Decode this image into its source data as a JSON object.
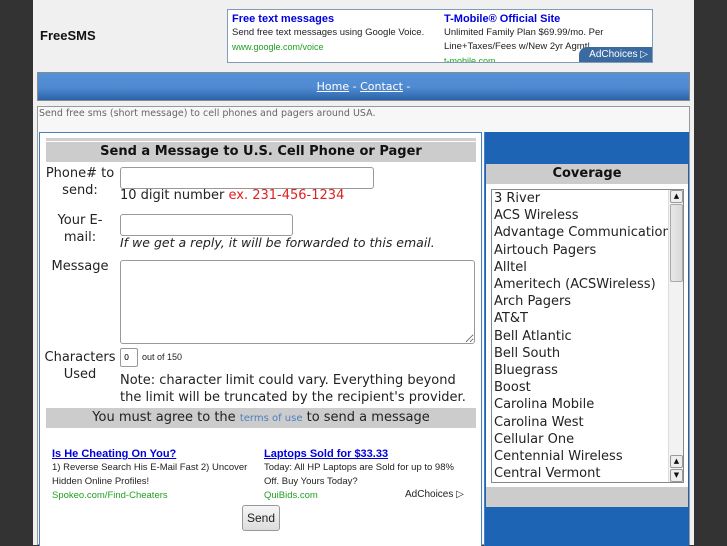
{
  "site": {
    "title": "FreeSMS"
  },
  "top_ad": {
    "ads": [
      {
        "title": "Free text messages",
        "body": "Send free text messages using Google Voice.",
        "url": "www.google.com/voice"
      },
      {
        "title": "T-Mobile® Official Site",
        "body": "Unlimited Family Plan $69.99/mo. Per Line+Taxes/Fees w/New 2yr Agmt!",
        "url": "t-mobile.com"
      }
    ],
    "adchoices": "AdChoices ▷"
  },
  "nav": {
    "home": "Home",
    "sep1": " - ",
    "contact": "Contact",
    "sep2": " -"
  },
  "intro": "Send free sms (short message) to cell phones and pagers around USA.",
  "form": {
    "header": "Send a Message to U.S. Cell Phone or Pager",
    "phone_label": "Phone# to send:",
    "phone_value": "",
    "phone_hint": "10 digit number ",
    "phone_example": "ex. 231-456-1234",
    "email_label": "Your E-mail:",
    "email_value": "",
    "email_hint": "If we get a reply, it will be forwarded to this email.",
    "message_label": "Message",
    "message_value": "",
    "chars_label": "Characters Used",
    "chars_value": "0",
    "chars_limit": "out of 150",
    "note": "Note: character limit could vary. Everything beyond the limit will be truncated by the recipient's provider.",
    "terms_prefix": "You must agree to the ",
    "terms_link": "terms of use",
    "terms_suffix": " to send a message",
    "send_label": "Send"
  },
  "bottom_ads": {
    "ads": [
      {
        "title": "Is He Cheating On You?",
        "body": "1) Reverse Search His E-Mail Fast 2) Uncover Hidden Online Profiles!",
        "url": "Spokeo.com/Find-Cheaters"
      },
      {
        "title": "Laptops Sold for $33.33",
        "body": "Today: All HP Laptops are Sold for up to 98% Off. Buy Yours Today?",
        "url": "QuiBids.com"
      }
    ],
    "adchoices": "AdChoices ▷"
  },
  "coverage": {
    "header": "Coverage",
    "items": [
      "3 River",
      "ACS Wireless",
      "Advantage Communications",
      "Airtouch Pagers",
      "Alltel",
      "Ameritech (ACSWireless)",
      "Arch Pagers",
      "AT&T",
      "Bell Atlantic",
      "Bell South",
      "Bluegrass",
      "Boost",
      "Carolina Mobile",
      "Carolina West",
      "Cellular One",
      "Centennial Wireless",
      "Central Vermont"
    ]
  }
}
